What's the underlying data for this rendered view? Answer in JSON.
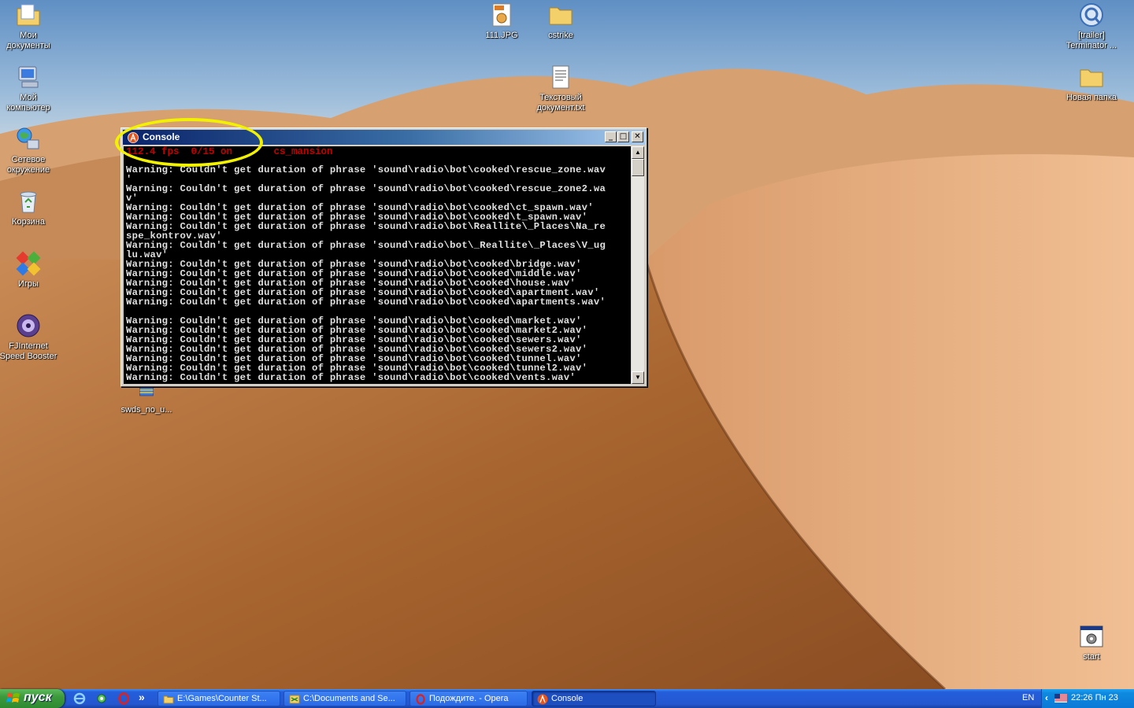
{
  "desktop": {
    "icons_left": [
      {
        "label": "Мои\nдокументы",
        "icon": "my-documents-icon"
      },
      {
        "label": "Мой\nкомпьютер",
        "icon": "my-computer-icon"
      },
      {
        "label": "Сетевое\nокружение",
        "icon": "network-places-icon"
      },
      {
        "label": "Корзина",
        "icon": "recycle-bin-icon"
      },
      {
        "label": "Игры",
        "icon": "games-icon"
      },
      {
        "label": "FJInternet\nSpeed Booster",
        "icon": "speed-booster-icon"
      }
    ],
    "icons_other": [
      {
        "label": "111.JPG",
        "icon": "jpg-file-icon"
      },
      {
        "label": "cstrike",
        "icon": "folder-icon"
      },
      {
        "label": "Текстовый\nдокумент.txt",
        "icon": "text-document-icon"
      },
      {
        "label": "[trailer]\nTerminator ...",
        "icon": "quicktime-icon"
      },
      {
        "label": "Новая папка",
        "icon": "folder-icon"
      },
      {
        "label": "swds_no_u...",
        "icon": "archive-icon"
      },
      {
        "label": "start",
        "icon": "batch-file-icon"
      }
    ]
  },
  "console": {
    "title": "Console",
    "status": "112.4 fps  0/15 on       cs_mansion",
    "buttons": {
      "minimize": "_",
      "maximize": "□",
      "close": "✕"
    },
    "log": [
      "Warning: Couldn't get duration of phrase 'sound\\radio\\bot\\cooked\\rescue_zone.wav",
      "'",
      "Warning: Couldn't get duration of phrase 'sound\\radio\\bot\\cooked\\rescue_zone2.wa",
      "v'",
      "Warning: Couldn't get duration of phrase 'sound\\radio\\bot\\cooked\\ct_spawn.wav'",
      "Warning: Couldn't get duration of phrase 'sound\\radio\\bot\\cooked\\t_spawn.wav'",
      "Warning: Couldn't get duration of phrase 'sound\\radio\\bot\\Reallite\\_Places\\Na_re",
      "spe_kontrov.wav'",
      "Warning: Couldn't get duration of phrase 'sound\\radio\\bot\\_Reallite\\_Places\\V_ug",
      "lu.wav'",
      "Warning: Couldn't get duration of phrase 'sound\\radio\\bot\\cooked\\bridge.wav'",
      "Warning: Couldn't get duration of phrase 'sound\\radio\\bot\\cooked\\middle.wav'",
      "Warning: Couldn't get duration of phrase 'sound\\radio\\bot\\cooked\\house.wav'",
      "Warning: Couldn't get duration of phrase 'sound\\radio\\bot\\cooked\\apartment.wav'",
      "Warning: Couldn't get duration of phrase 'sound\\radio\\bot\\cooked\\apartments.wav'",
      "",
      "Warning: Couldn't get duration of phrase 'sound\\radio\\bot\\cooked\\market.wav'",
      "Warning: Couldn't get duration of phrase 'sound\\radio\\bot\\cooked\\market2.wav'",
      "Warning: Couldn't get duration of phrase 'sound\\radio\\bot\\cooked\\sewers.wav'",
      "Warning: Couldn't get duration of phrase 'sound\\radio\\bot\\cooked\\sewers2.wav'",
      "Warning: Couldn't get duration of phrase 'sound\\radio\\bot\\cooked\\tunnel.wav'",
      "Warning: Couldn't get duration of phrase 'sound\\radio\\bot\\cooked\\tunnel2.wav'",
      "Warning: Couldn't get duration of phrase 'sound\\radio\\bot\\cooked\\vents.wav'"
    ]
  },
  "taskbar": {
    "start_label": "пуск",
    "quicklaunch_more": "»",
    "tasks": [
      {
        "label": "E:\\Games\\Counter St...",
        "icon": "folder-icon",
        "active": false
      },
      {
        "label": "C:\\Documents and Se...",
        "icon": "explorer-icon",
        "active": false
      },
      {
        "label": "Подождите. - Opera",
        "icon": "opera-icon",
        "active": false
      },
      {
        "label": "Console",
        "icon": "halflife-icon",
        "active": true
      }
    ],
    "language": "EN",
    "tray_arrow": "‹",
    "clock": "22:26 Пн 23"
  },
  "colors": {
    "console_status": "#c00000",
    "console_text": "#e0e0e0",
    "highlight": "#f2f200",
    "taskbar": "#245edb",
    "start": "#3c9a3c"
  }
}
